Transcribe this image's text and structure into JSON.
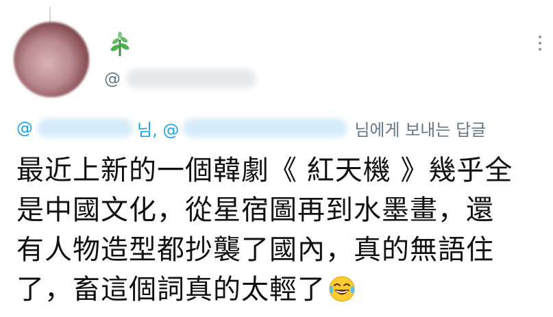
{
  "tweet": {
    "author": {
      "avatar": "avatar-blurred",
      "name_icon": "sprout-icon",
      "handle_prefix": "@"
    },
    "reply_to": {
      "at_sign_1": "@",
      "separator": "님, @",
      "suffix": "님에게 보내는 답글"
    },
    "body_lines": [
      "最近上新的一個韓劇《 紅天機 》幾乎全",
      "是中國文化，從星宿圖再到水墨畫，還",
      "有人物造型都抄襲了國內，真的無語住",
      "了，畜這個詞真的太輕了"
    ],
    "emoji": "face-with-tears-of-joy",
    "colors": {
      "link_blue": "#1da1f2",
      "secondary_gray": "#657786",
      "text": "#111111"
    }
  }
}
